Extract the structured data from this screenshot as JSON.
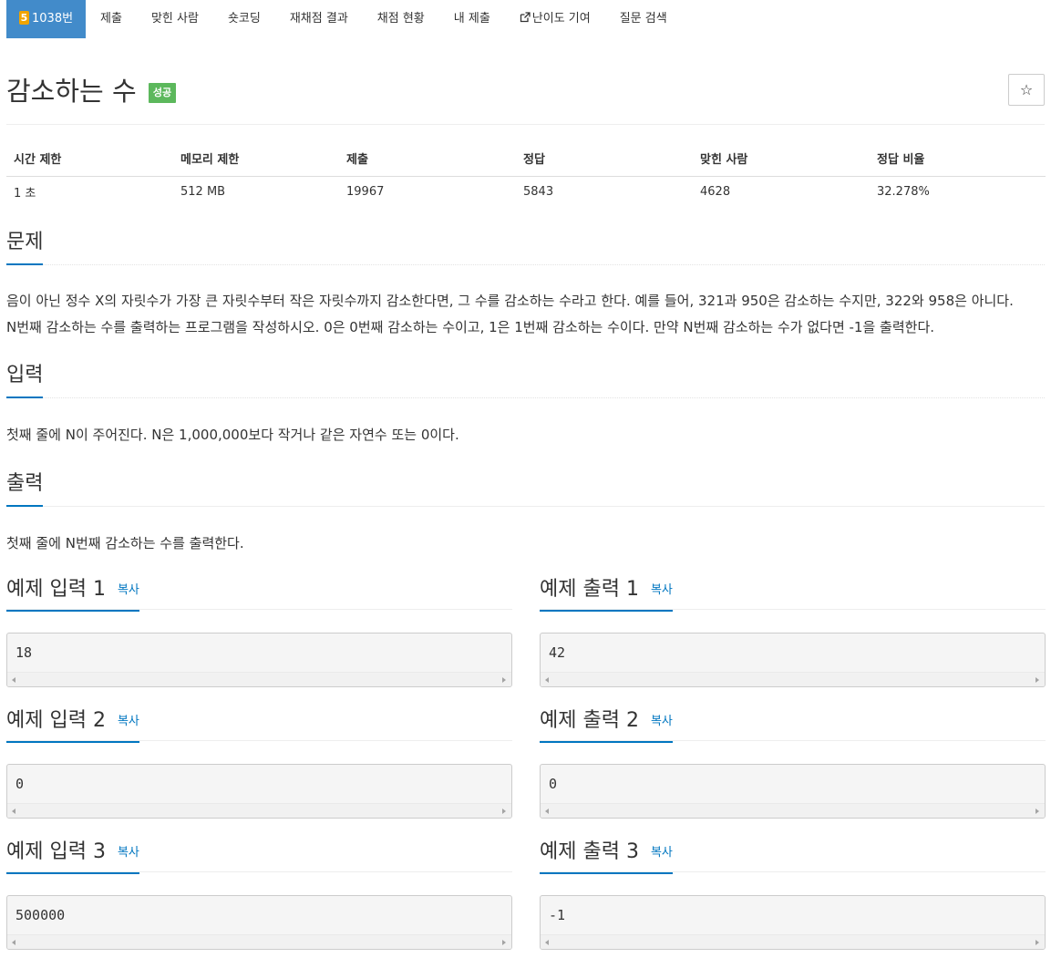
{
  "nav": {
    "problem_tier": "5",
    "problem_number": "1038번",
    "tabs": [
      "제출",
      "맞힌 사람",
      "숏코딩",
      "재채점 결과",
      "채점 현황",
      "내 제출",
      "난이도 기여",
      "질문 검색"
    ]
  },
  "problem": {
    "title": "감소하는 수",
    "badge": "성공",
    "star": "☆"
  },
  "stats": {
    "headers": [
      "시간 제한",
      "메모리 제한",
      "제출",
      "정답",
      "맞힌 사람",
      "정답 비율"
    ],
    "values": [
      "1 초",
      "512 MB",
      "19967",
      "5843",
      "4628",
      "32.278%"
    ]
  },
  "sections": {
    "description": {
      "heading": "문제",
      "lines": [
        "음이 아닌 정수 X의 자릿수가 가장 큰 자릿수부터 작은 자릿수까지 감소한다면, 그 수를 감소하는 수라고 한다. 예를 들어, 321과 950은 감소하는 수지만, 322와 958은 아니다.",
        "N번째 감소하는 수를 출력하는 프로그램을 작성하시오. 0은 0번째 감소하는 수이고, 1은 1번째 감소하는 수이다. 만약 N번째 감소하는 수가 없다면 -1을 출력한다."
      ]
    },
    "input": {
      "heading": "입력",
      "text": "첫째 줄에 N이 주어진다. N은 1,000,000보다 작거나 같은 자연수 또는 0이다."
    },
    "output": {
      "heading": "출력",
      "text": "첫째 줄에 N번째 감소하는 수를 출력한다."
    }
  },
  "copy_label": "복사",
  "samples": [
    {
      "input_title": "예제 입력 1",
      "input": "18",
      "output_title": "예제 출력 1",
      "output": "42"
    },
    {
      "input_title": "예제 입력 2",
      "input": "0",
      "output_title": "예제 출력 2",
      "output": "0"
    },
    {
      "input_title": "예제 입력 3",
      "input": "500000",
      "output_title": "예제 출력 3",
      "output": "-1"
    }
  ],
  "colors": {
    "active_tab": "#428bca",
    "tier_badge": "#f0a400",
    "success_badge": "#5cb85c",
    "heading_underline": "#0076c0"
  },
  "icons": {
    "external_link": "external-link-icon",
    "star": "star-icon"
  }
}
